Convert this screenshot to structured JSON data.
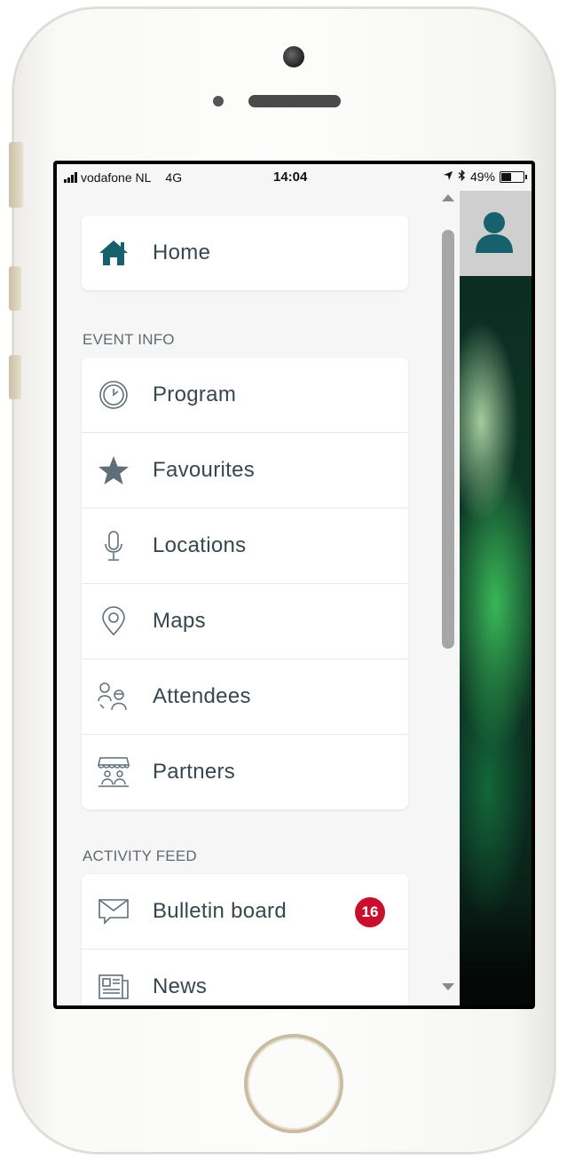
{
  "statusbar": {
    "carrier": "vodafone NL",
    "network": "4G",
    "time": "14:04",
    "battery": "49%",
    "battery_level": 0.49
  },
  "menu": {
    "home": {
      "label": "Home",
      "icon": "home-icon"
    },
    "sections": [
      {
        "title": "EVENT INFO",
        "items": [
          {
            "label": "Program",
            "icon": "clock-icon"
          },
          {
            "label": "Favourites",
            "icon": "star-icon"
          },
          {
            "label": "Locations",
            "icon": "microphone-icon"
          },
          {
            "label": "Maps",
            "icon": "map-pin-icon"
          },
          {
            "label": "Attendees",
            "icon": "attendees-icon"
          },
          {
            "label": "Partners",
            "icon": "storefront-icon"
          }
        ]
      },
      {
        "title": "ACTIVITY FEED",
        "items": [
          {
            "label": "Bulletin board",
            "icon": "message-icon",
            "badge": "16"
          },
          {
            "label": "News",
            "icon": "newspaper-icon"
          }
        ]
      }
    ]
  },
  "colors": {
    "accent": "#17606e",
    "icon": "#5f6f78",
    "badge": "#c8102e"
  }
}
